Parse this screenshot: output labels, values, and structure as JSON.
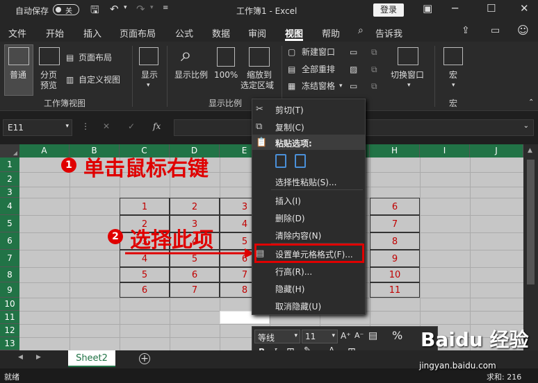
{
  "titlebar": {
    "autosave": "自动保存",
    "toggle": "关",
    "title": "工作簿1  -  Excel",
    "login": "登录"
  },
  "menubar": {
    "items": [
      "文件",
      "开始",
      "插入",
      "页面布局",
      "公式",
      "数据",
      "审阅",
      "视图",
      "帮助",
      "告诉我"
    ],
    "active_index": 7
  },
  "ribbon": {
    "normal": "普通",
    "pagebreak": [
      "分页",
      "预览"
    ],
    "page_layout": "页面布局",
    "custom_view": "自定义视图",
    "show": "显示",
    "zoom": "显示比例",
    "zoom100": "100%",
    "zoom_sel": [
      "缩放到",
      "选定区域"
    ],
    "new_window": "新建窗口",
    "arrange_all": "全部重排",
    "freeze": "冻结窗格",
    "switch_window": "切换窗口",
    "macro": "宏",
    "group_workbook_views": "工作簿视图",
    "group_zoom": "显示比例",
    "group_macro": "宏"
  },
  "formula": {
    "namebox": "E11",
    "fx": "fx"
  },
  "grid": {
    "columns": [
      "A",
      "B",
      "C",
      "D",
      "E",
      "F",
      "G",
      "H",
      "I",
      "J"
    ],
    "rows": [
      "1",
      "2",
      "3",
      "4",
      "5",
      "6",
      "7",
      "8",
      "9",
      "10",
      "11",
      "12",
      "13"
    ],
    "table": [
      [
        "1",
        "2",
        "3",
        "",
        "",
        "6"
      ],
      [
        "2",
        "3",
        "4",
        "",
        "",
        "7"
      ],
      [
        "3",
        "4",
        "5",
        "",
        "",
        "8"
      ],
      [
        "4",
        "5",
        "6",
        "",
        "",
        "9"
      ],
      [
        "5",
        "6",
        "7",
        "",
        "",
        "10"
      ],
      [
        "6",
        "7",
        "8",
        "",
        "",
        "11"
      ]
    ]
  },
  "context_menu": {
    "cut": "剪切(T)",
    "copy": "复制(C)",
    "paste_options": "粘贴选项:",
    "paste_special": "选择性粘贴(S)...",
    "insert": "插入(I)",
    "delete": "删除(D)",
    "clear": "清除内容(N)",
    "format_cells": "设置单元格格式(F)...",
    "row_height": "行高(R)...",
    "hide": "隐藏(H)",
    "unhide": "取消隐藏(U)"
  },
  "mini_toolbar": {
    "font": "等线",
    "size": "11",
    "percent": "%"
  },
  "annotations": {
    "step1_num": "1",
    "step1_text": "单击鼠标右键",
    "step2_num": "2",
    "step2_text": "选择此项"
  },
  "sheets": {
    "tab": "Sheet2",
    "add": "+"
  },
  "status": {
    "ready": "就绪",
    "sum": "求和: 216"
  },
  "watermark": {
    "line1": "Baidu 经验",
    "line2": "jingyan.baidu.com"
  },
  "colors": {
    "excel_green": "#217346",
    "annotation_red": "#e00000",
    "cell_text": "#c00000"
  }
}
